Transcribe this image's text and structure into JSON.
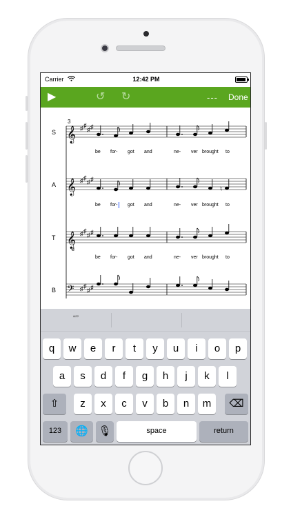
{
  "status_bar": {
    "carrier": "Carrier",
    "time": "12:42 PM",
    "wifi_icon": "wifi-icon",
    "battery_icon": "battery-icon"
  },
  "toolbar": {
    "play_icon": "▶",
    "undo_icon": "↺",
    "redo_icon": "↻",
    "dashes": "---",
    "done_label": "Done"
  },
  "score": {
    "measure_number": "3",
    "staves": [
      {
        "label": "S",
        "lyrics": [
          "be",
          "for-",
          "got",
          "and",
          "ne-",
          "ver",
          "brought",
          "to"
        ]
      },
      {
        "label": "A",
        "lyrics": [
          "be",
          "for-",
          "got",
          "and",
          "ne-",
          "ver",
          "brought",
          "to"
        ]
      },
      {
        "label": "T",
        "lyrics": [
          "be",
          "for-",
          "got",
          "and",
          "ne-",
          "ver",
          "brought",
          "to"
        ]
      },
      {
        "label": "B",
        "lyrics": []
      }
    ]
  },
  "keyboard": {
    "suggestion": "“”",
    "row1": [
      "q",
      "w",
      "e",
      "r",
      "t",
      "y",
      "u",
      "i",
      "o",
      "p"
    ],
    "row2": [
      "a",
      "s",
      "d",
      "f",
      "g",
      "h",
      "j",
      "k",
      "l"
    ],
    "row3": [
      "z",
      "x",
      "c",
      "v",
      "b",
      "n",
      "m"
    ],
    "shift_icon": "⇧",
    "delete_icon": "⌫",
    "numbers_label": "123",
    "globe_icon": "🌐",
    "mic_icon": "🎙",
    "space_label": "space",
    "return_label": "return"
  },
  "colors": {
    "toolbar_bg": "#5aa61f",
    "keyboard_bg": "#d1d3d9",
    "cursor": "#2255ff"
  }
}
